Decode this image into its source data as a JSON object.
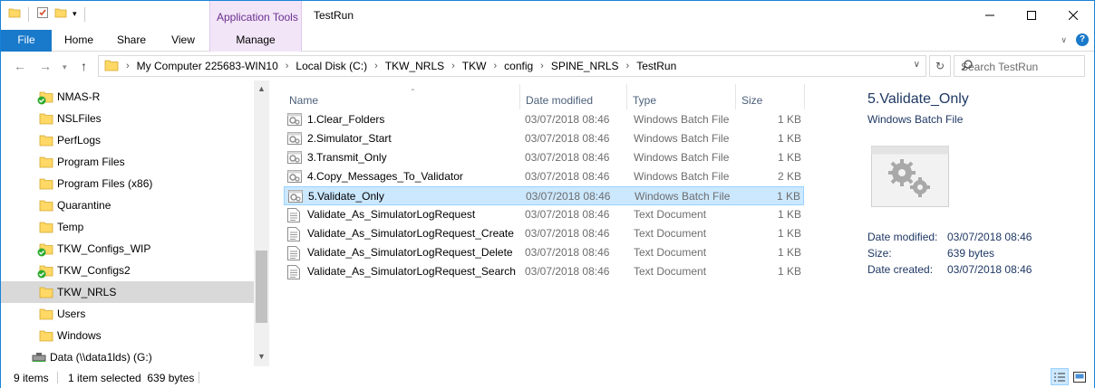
{
  "window": {
    "title": "TestRun",
    "context_tab_group": "Application Tools"
  },
  "ribbon": {
    "tabs": [
      {
        "label": "File"
      },
      {
        "label": "Home"
      },
      {
        "label": "Share"
      },
      {
        "label": "View"
      },
      {
        "label": "Manage"
      }
    ]
  },
  "address": {
    "crumbs": [
      "My Computer 225683-WIN10",
      "Local Disk (C:)",
      "TKW_NRLS",
      "TKW",
      "config",
      "SPINE_NRLS",
      "TestRun"
    ],
    "search_placeholder": "Search TestRun"
  },
  "navpane": {
    "items": [
      {
        "label": "NMAS-R",
        "sync": true
      },
      {
        "label": "NSLFiles",
        "sync": false
      },
      {
        "label": "PerfLogs",
        "sync": false
      },
      {
        "label": "Program Files",
        "sync": false
      },
      {
        "label": "Program Files (x86)",
        "sync": false
      },
      {
        "label": "Quarantine",
        "sync": false
      },
      {
        "label": "Temp",
        "sync": false
      },
      {
        "label": "TKW_Configs_WIP",
        "sync": true
      },
      {
        "label": "TKW_Configs2",
        "sync": true
      },
      {
        "label": "TKW_NRLS",
        "sync": false,
        "selected": true
      },
      {
        "label": "Users",
        "sync": false
      },
      {
        "label": "Windows",
        "sync": false
      },
      {
        "label": "Data (\\\\data1lds) (G:)",
        "drive": true
      }
    ]
  },
  "filelist": {
    "columns": {
      "name": "Name",
      "date": "Date modified",
      "type": "Type",
      "size": "Size"
    },
    "rows": [
      {
        "name": "1.Clear_Folders",
        "date": "03/07/2018 08:46",
        "type": "Windows Batch File",
        "size": "1 KB",
        "icon": "batch-file-icon"
      },
      {
        "name": "2.Simulator_Start",
        "date": "03/07/2018 08:46",
        "type": "Windows Batch File",
        "size": "1 KB",
        "icon": "batch-file-icon"
      },
      {
        "name": "3.Transmit_Only",
        "date": "03/07/2018 08:46",
        "type": "Windows Batch File",
        "size": "1 KB",
        "icon": "batch-file-icon"
      },
      {
        "name": "4.Copy_Messages_To_Validator",
        "date": "03/07/2018 08:46",
        "type": "Windows Batch File",
        "size": "2 KB",
        "icon": "batch-file-icon"
      },
      {
        "name": "5.Validate_Only",
        "date": "03/07/2018 08:46",
        "type": "Windows Batch File",
        "size": "1 KB",
        "icon": "batch-file-icon",
        "selected": true
      },
      {
        "name": "Validate_As_SimulatorLogRequest",
        "date": "03/07/2018 08:46",
        "type": "Text Document",
        "size": "1 KB",
        "icon": "text-file-icon"
      },
      {
        "name": "Validate_As_SimulatorLogRequest_Create",
        "date": "03/07/2018 08:46",
        "type": "Text Document",
        "size": "1 KB",
        "icon": "text-file-icon"
      },
      {
        "name": "Validate_As_SimulatorLogRequest_Delete",
        "date": "03/07/2018 08:46",
        "type": "Text Document",
        "size": "1 KB",
        "icon": "text-file-icon"
      },
      {
        "name": "Validate_As_SimulatorLogRequest_Search",
        "date": "03/07/2018 08:46",
        "type": "Text Document",
        "size": "1 KB",
        "icon": "text-file-icon"
      }
    ]
  },
  "details": {
    "title": "5.Validate_Only",
    "type": "Windows Batch File",
    "props": [
      {
        "key": "Date modified:",
        "value": "03/07/2018 08:46"
      },
      {
        "key": "Size:",
        "value": "639 bytes"
      },
      {
        "key": "Date created:",
        "value": "03/07/2018 08:46"
      }
    ]
  },
  "status": {
    "count": "9 items",
    "selection": "1 item selected  639 bytes"
  },
  "colors": {
    "accent": "#1979ca",
    "selection_bg": "#cce8ff",
    "selection_border": "#99d1ff",
    "context_tab": "#f1e5f7",
    "folder": "#ffd865"
  }
}
